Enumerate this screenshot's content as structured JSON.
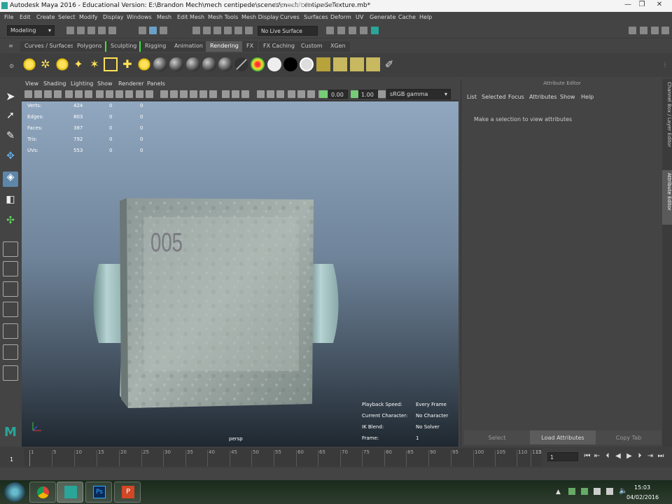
{
  "window": {
    "title": "Autodesk Maya 2016 - Educational Version: E:\\Brandon Mech\\mech centipede\\scenes\\mech centipedeTexture.mb*",
    "ghost_title": "Microsoft PowerPoint",
    "minimize_label": "—",
    "maximize_label": "❐",
    "close_label": "✕"
  },
  "menubar": [
    "File",
    "Edit",
    "Create",
    "Select",
    "Modify",
    "Display",
    "Windows",
    "Mesh",
    "Edit Mesh",
    "Mesh Tools",
    "Mesh Display",
    "Curves",
    "Surfaces",
    "Deform",
    "UV",
    "Generate",
    "Cache",
    "Help"
  ],
  "status": {
    "mode": "Modeling",
    "live_surface": "No Live Surface"
  },
  "shelf": {
    "tabs": [
      "Curves / Surfaces",
      "Polygons",
      "Sculpting",
      "Rigging",
      "Animation",
      "Rendering",
      "FX",
      "FX Caching",
      "Custom",
      "XGen"
    ],
    "active_tab": "Rendering"
  },
  "viewport": {
    "menu": [
      "View",
      "Shading",
      "Lighting",
      "Show",
      "Renderer",
      "Panels"
    ],
    "exposure": "0.00",
    "gamma": "1.00",
    "color_space": "sRGB gamma",
    "camera": "persp",
    "texture_label": "005",
    "hud_stats": [
      {
        "label": "Verts:",
        "values": [
          "424",
          "0",
          "0"
        ]
      },
      {
        "label": "Edges:",
        "values": [
          "803",
          "0",
          "0"
        ]
      },
      {
        "label": "Faces:",
        "values": [
          "387",
          "0",
          "0"
        ]
      },
      {
        "label": "Tris:",
        "values": [
          "792",
          "0",
          "0"
        ]
      },
      {
        "label": "UVs:",
        "values": [
          "553",
          "0",
          "0"
        ]
      }
    ],
    "hud_info": [
      {
        "label": "Playback Speed:",
        "value": "Every Frame"
      },
      {
        "label": "Current Character:",
        "value": "No Character"
      },
      {
        "label": "IK Blend:",
        "value": "No Solver"
      },
      {
        "label": "Frame:",
        "value": "1"
      }
    ]
  },
  "attribute_editor": {
    "header": "Attribute Editor",
    "menu": [
      "List",
      "Selected",
      "Focus",
      "Attributes",
      "Show",
      "Help"
    ],
    "message": "Make a selection to view attributes",
    "buttons": [
      "Select",
      "Load Attributes",
      "Copy Tab"
    ]
  },
  "side_tabs": [
    "Channel Box / Layer Editor",
    "Attribute Editor"
  ],
  "timeline": {
    "ticks": [
      "1",
      "5",
      "10",
      "15",
      "20",
      "25",
      "30",
      "35",
      "40",
      "45",
      "50",
      "55",
      "60",
      "65",
      "70",
      "75",
      "80",
      "85",
      "90",
      "95",
      "100",
      "105",
      "110",
      "115",
      "12"
    ],
    "current_frame": "1",
    "current_frame_field": "1"
  },
  "taskbar": {
    "time": "15:03",
    "date": "04/02/2016"
  }
}
